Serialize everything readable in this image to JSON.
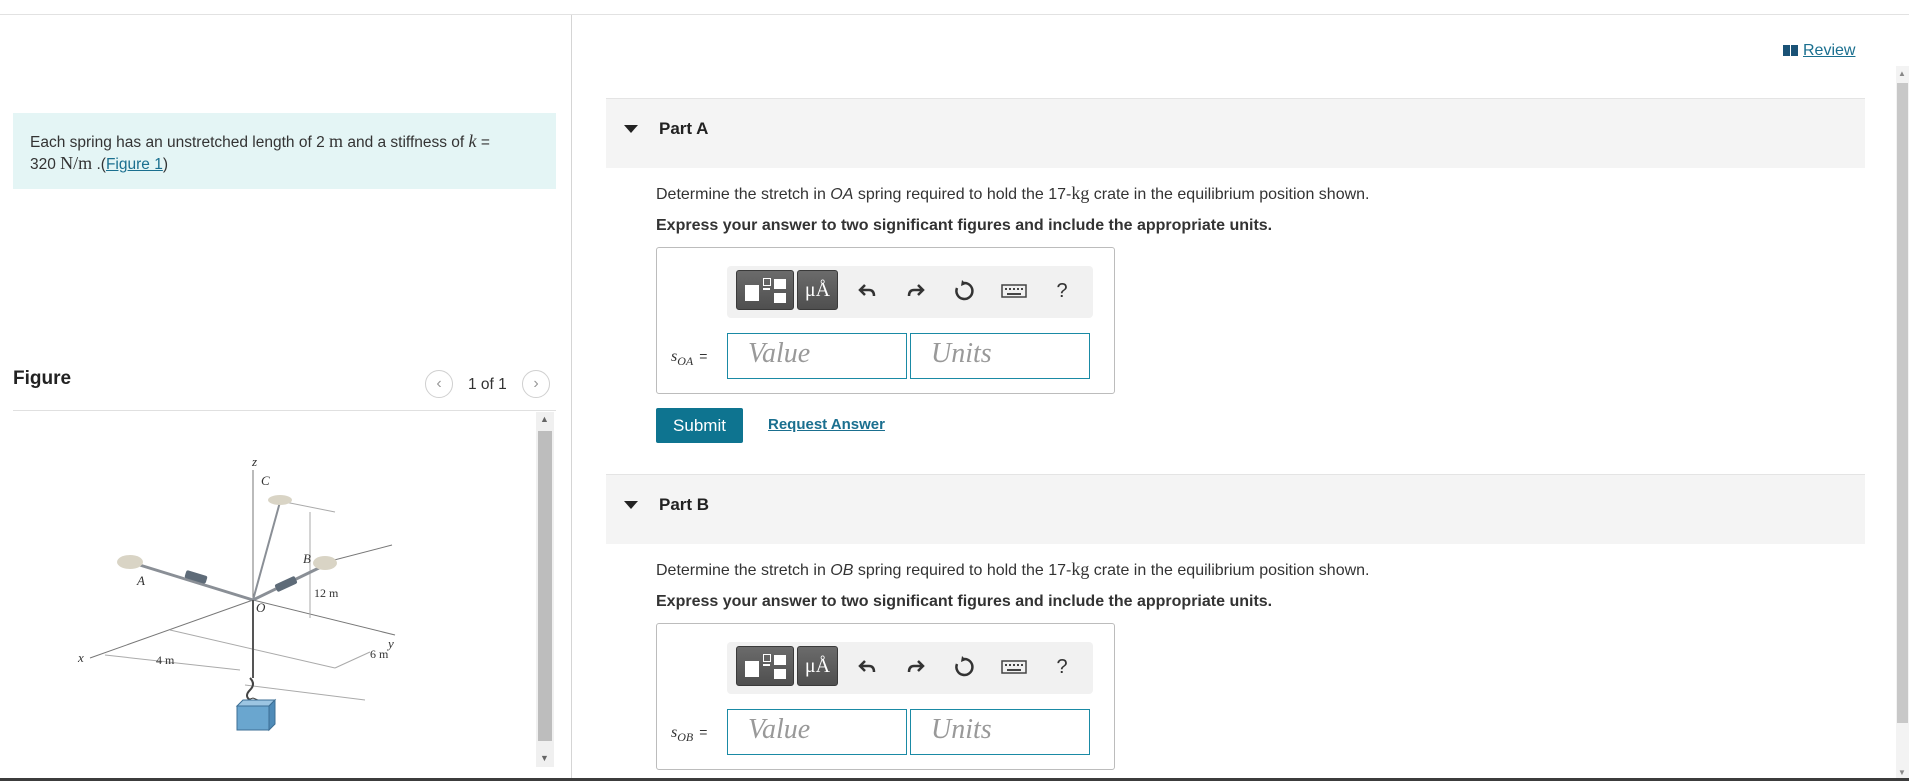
{
  "review": {
    "label": "Review"
  },
  "problem": {
    "text1": "Each spring has an unstretched length of 2 ",
    "unit_m": "m",
    "text2": " and a stiffness of ",
    "k": "k",
    "eq": " =",
    "value": "320 ",
    "unit_k": "N/m",
    "text3": " .(",
    "figure_link": "Figure 1",
    "text4": ")"
  },
  "figure": {
    "title": "Figure",
    "pager": "1 of 1",
    "labels": {
      "z": "z",
      "c": "C",
      "a": "A",
      "b": "B",
      "o": "O",
      "x": "x",
      "y": "y",
      "d12": "12 m",
      "d4": "4 m",
      "d6": "6 m"
    },
    "crate_color": "#6aa6cf"
  },
  "parts": [
    {
      "title": "Part A",
      "question_pre": "Determine the stretch in ",
      "spring": "OA",
      "question_mid": " spring required to hold the 17-",
      "kg": "kg",
      "question_post": " crate in the equilibrium position shown.",
      "instruction": "Express your answer to two significant figures and include the appropriate units.",
      "var": "s",
      "sub": "OA",
      "eq": "=",
      "value_placeholder": "Value",
      "units_placeholder": "Units"
    },
    {
      "title": "Part B",
      "question_pre": "Determine the stretch in ",
      "spring": "OB",
      "question_mid": " spring required to hold the 17-",
      "kg": "kg",
      "question_post": " crate in the equilibrium position shown.",
      "instruction": "Express your answer to two significant figures and include the appropriate units.",
      "var": "s",
      "sub": "OB",
      "eq": "=",
      "value_placeholder": "Value",
      "units_placeholder": "Units"
    }
  ],
  "toolbar": {
    "mu": "μÅ",
    "help": "?"
  },
  "actions": {
    "submit": "Submit",
    "request": "Request Answer"
  },
  "colors": {
    "accent": "#0e7490",
    "link": "#1a6f8f",
    "problem_bg": "#e4f5f5"
  }
}
